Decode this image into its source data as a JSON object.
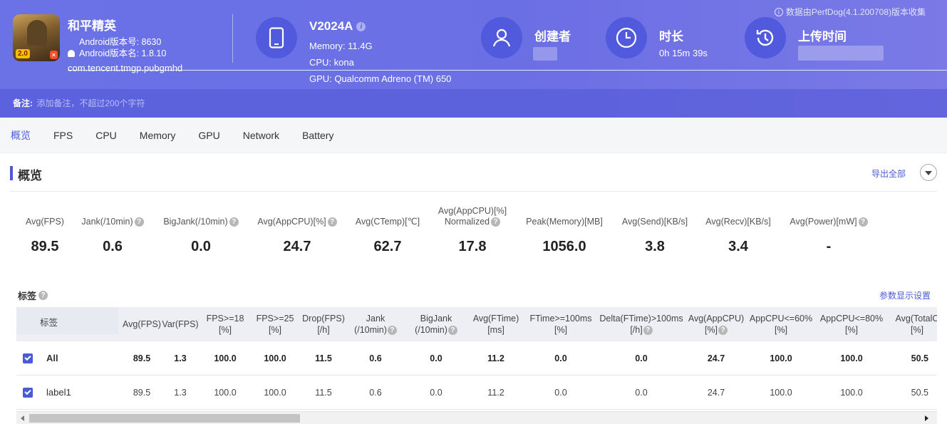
{
  "header": {
    "source_note": "数据由PerfDog(4.1.200708)版本收集",
    "app": {
      "name": "和平精英",
      "icon_badge": "2.0",
      "version_name_line": "Android版本名: 1.8.10",
      "version_code_line": "Android版本号: 8630",
      "package": "com.tencent.tmgp.pubgmhd"
    },
    "device": {
      "name": "V2024A",
      "memory": "Memory: 11.4G",
      "cpu": "CPU: kona",
      "gpu": "GPU: Qualcomm Adreno (TM) 650"
    },
    "creator_title": "创建者",
    "duration_title": "时长",
    "duration_value": "0h 15m 39s",
    "upload_title": "上传时间",
    "note_label": "备注:",
    "note_placeholder": "添加备注，不超过200个字符"
  },
  "tabs": [
    "概览",
    "FPS",
    "CPU",
    "Memory",
    "GPU",
    "Network",
    "Battery"
  ],
  "overview": {
    "title": "概览",
    "export_label": "导出全部",
    "metrics": [
      {
        "label": "Avg(FPS)",
        "value": "89.5"
      },
      {
        "label": "Jank(/10min)",
        "value": "0.6"
      },
      {
        "label": "BigJank(/10min)",
        "value": "0.0"
      },
      {
        "label": "Avg(AppCPU)[%]",
        "value": "24.7"
      },
      {
        "label": "Avg(CTemp)[℃]",
        "value": "62.7"
      },
      {
        "label_line1": "Avg(AppCPU)[%]",
        "label_line2": "Normalized",
        "value": "17.8"
      },
      {
        "label": "Peak(Memory)[MB]",
        "value": "1056.0"
      },
      {
        "label": "Avg(Send)[KB/s]",
        "value": "3.8"
      },
      {
        "label": "Avg(Recv)[KB/s]",
        "value": "3.4"
      },
      {
        "label": "Avg(Power)[mW]",
        "value": "-"
      }
    ]
  },
  "labels_section": {
    "title": "标签",
    "param_link": "参数显示设置",
    "label_col_header": "标签",
    "columns": [
      {
        "l1": "Avg(FPS)",
        "l2": ""
      },
      {
        "l1": "Var(FPS)",
        "l2": ""
      },
      {
        "l1": "FPS>=18",
        "l2": "[%]"
      },
      {
        "l1": "FPS>=25",
        "l2": "[%]"
      },
      {
        "l1": "Drop(FPS)",
        "l2": "[/h]"
      },
      {
        "l1": "Jank",
        "l2": "(/10min)"
      },
      {
        "l1": "BigJank",
        "l2": "(/10min)"
      },
      {
        "l1": "Avg(FTime)",
        "l2": "[ms]"
      },
      {
        "l1": "FTime>=100ms",
        "l2": "[%]"
      },
      {
        "l1": "Delta(FTime)>100ms",
        "l2": "[/h]"
      },
      {
        "l1": "Avg(AppCPU)",
        "l2": "[%]"
      },
      {
        "l1": "AppCPU<=60%",
        "l2": "[%]"
      },
      {
        "l1": "AppCPU<=80%",
        "l2": "[%]"
      },
      {
        "l1": "Avg(TotalC",
        "l2": "[%]"
      }
    ],
    "rows": [
      {
        "label": "All",
        "values": [
          "89.5",
          "1.3",
          "100.0",
          "100.0",
          "11.5",
          "0.6",
          "0.0",
          "11.2",
          "0.0",
          "0.0",
          "24.7",
          "100.0",
          "100.0",
          "50.5"
        ]
      },
      {
        "label": "label1",
        "values": [
          "89.5",
          "1.3",
          "100.0",
          "100.0",
          "11.5",
          "0.6",
          "0.0",
          "11.2",
          "0.0",
          "0.0",
          "24.7",
          "100.0",
          "100.0",
          "50.5"
        ]
      }
    ]
  }
}
